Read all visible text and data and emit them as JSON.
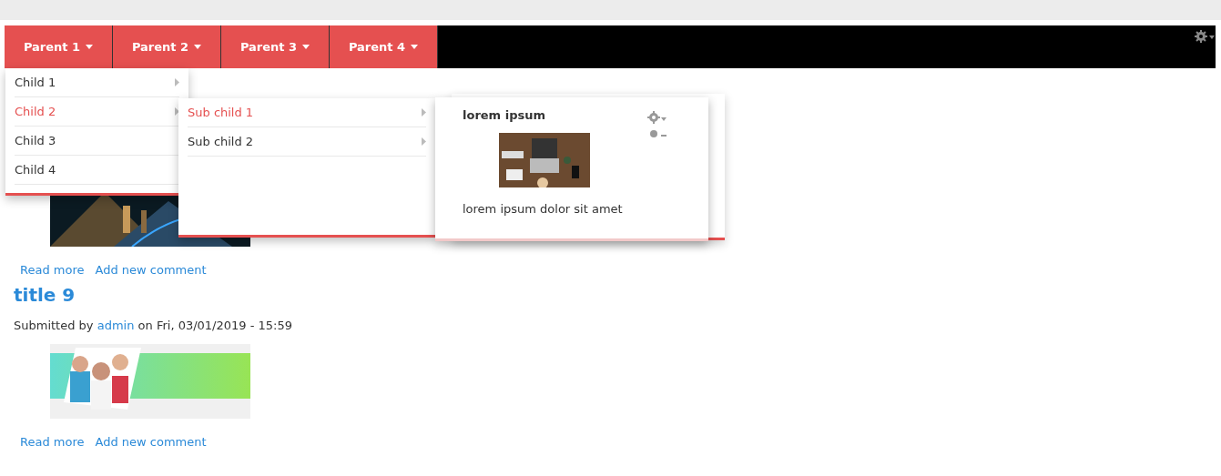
{
  "nav": {
    "items": [
      {
        "label": "Parent 1"
      },
      {
        "label": "Parent 2"
      },
      {
        "label": "Parent 3"
      },
      {
        "label": "Parent 4"
      }
    ]
  },
  "menu": {
    "items": [
      {
        "label": "Child 1",
        "selected": false,
        "has_submenu": true
      },
      {
        "label": "Child 2",
        "selected": true,
        "has_submenu": true
      },
      {
        "label": "Child 3",
        "selected": false,
        "has_submenu": false
      },
      {
        "label": "Child 4",
        "selected": false,
        "has_submenu": false
      }
    ]
  },
  "submenu": {
    "items": [
      {
        "label": "Sub child 1",
        "selected": true,
        "has_submenu": true
      },
      {
        "label": "Sub child 2",
        "selected": false,
        "has_submenu": true
      }
    ]
  },
  "mega_panel": {
    "title": "lorem ipsum",
    "text": "lorem ipsum dolor sit amet"
  },
  "articles": [
    {
      "links": [
        "Read more",
        "Add new comment"
      ]
    },
    {
      "title": "title 9",
      "submitted_prefix": "Submitted by",
      "author": "admin",
      "submitted_suffix": "on Fri, 03/01/2019 - 15:59",
      "links": [
        "Read more",
        "Add new comment"
      ]
    }
  ]
}
